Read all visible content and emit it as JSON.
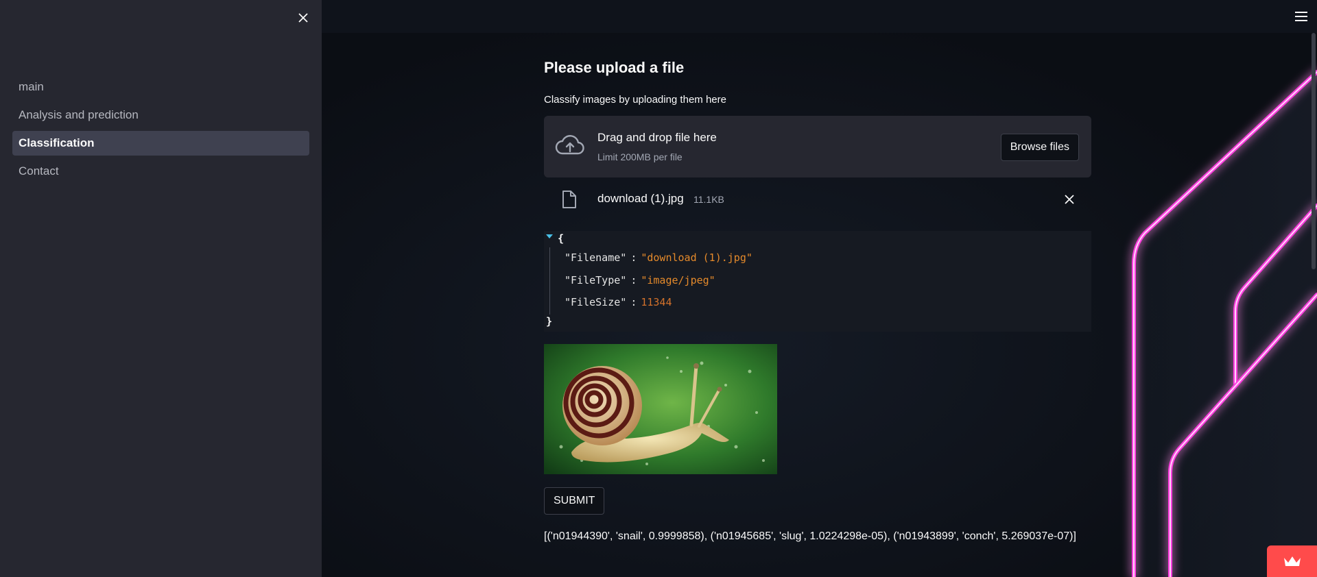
{
  "sidebar": {
    "items": [
      {
        "label": "main",
        "active": false
      },
      {
        "label": "Analysis and prediction",
        "active": false
      },
      {
        "label": "Classification",
        "active": true
      },
      {
        "label": "Contact",
        "active": false
      }
    ],
    "close_icon": "close-icon"
  },
  "header": {
    "menu_icon": "hamburger-icon"
  },
  "main": {
    "title": "Please upload a file",
    "uploader": {
      "label": "Classify images by uploading them here",
      "drop_text": "Drag and drop file here",
      "limit_text": "Limit 200MB per file",
      "browse_label": "Browse files",
      "icon": "cloud-upload-icon"
    },
    "uploaded_file": {
      "name": "download (1).jpg",
      "size": "11.1KB",
      "icon": "file-icon"
    },
    "json_view": {
      "open_brace": "{",
      "close_brace": "}",
      "rows": [
        {
          "key": "\"Filename\"",
          "value": "\"download (1).jpg\"",
          "type": "string"
        },
        {
          "key": "\"FileType\"",
          "value": "\"image/jpeg\"",
          "type": "string"
        },
        {
          "key": "\"FileSize\"",
          "value": "11344",
          "type": "number"
        }
      ]
    },
    "submit_label": "SUBMIT",
    "result": "[('n01944390', 'snail', 0.9999858), ('n01945685', 'slug', 1.0224298e-05), ('n01943899', 'conch', 5.269037e-07)]"
  },
  "colors": {
    "sidebar_bg": "#262730",
    "app_bg": "#0e1117",
    "accent": "#ff4b4b",
    "neon": "#ff3ee0",
    "json_string": "#e58a2b"
  }
}
